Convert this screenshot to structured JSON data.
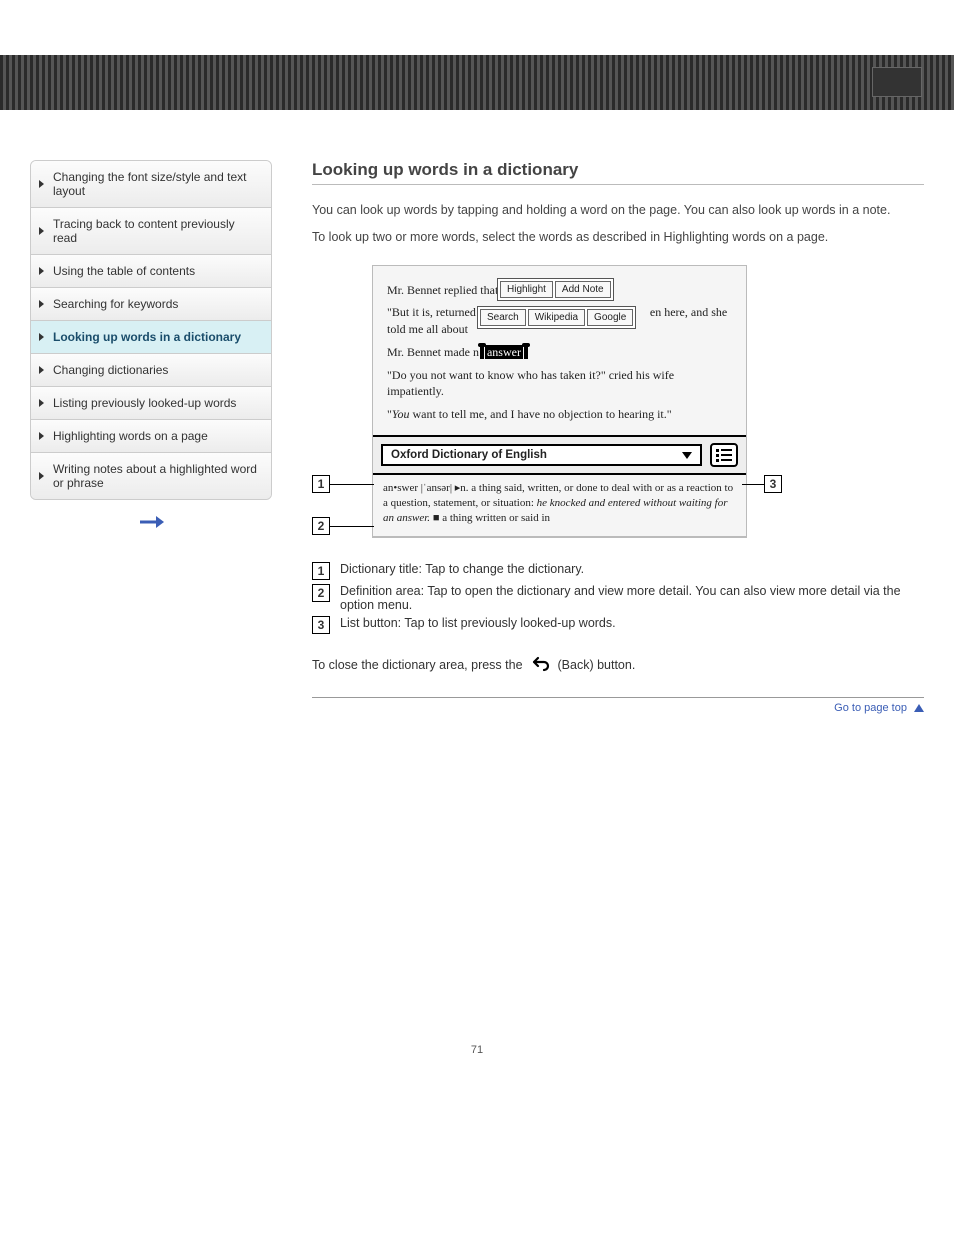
{
  "sidebar": {
    "items": [
      {
        "label": "Changing the font size/style and text layout"
      },
      {
        "label": "Tracing back to content previously read"
      },
      {
        "label": "Using the table of contents"
      },
      {
        "label": "Searching for keywords"
      },
      {
        "label": "Looking up words in a dictionary"
      },
      {
        "label": "Changing dictionaries"
      },
      {
        "label": "Listing previously looked-up words"
      },
      {
        "label": "Highlighting words on a page"
      },
      {
        "label": "Writing notes about a highlighted word or phrase"
      }
    ],
    "active_index": 4
  },
  "content": {
    "heading": "Looking up words in a dictionary",
    "intro_1": "You can look up words by tapping and holding a word on the page. You can also look up words in a note.",
    "intro_2": "To look up two or more words, select the words as described in Highlighting words on a page.",
    "legend": [
      "Dictionary title: Tap to change the dictionary.",
      "Definition area: Tap to open the dictionary and view more detail. You can also view more detail via the option menu.",
      "List button: Tap to list previously looked-up words."
    ],
    "close_note_before": "To close the dictionary area, press the",
    "close_note_after": "(Back) button.",
    "top_link": "Go to page top"
  },
  "ereader": {
    "para1_a": "Mr. Bennet replied that",
    "para2_a": "\"But it is, returned",
    "para2_b": "en here, and she told me all about",
    "para3_a": "Mr. Bennet made n",
    "selected_word": "answer",
    "para4": "\"Do you not want to know who has taken it?\" cried his wife impatiently.",
    "para5_a": "\"",
    "para5_em": "You",
    "para5_b": " want to tell me, and I have no objection to hearing it.\"",
    "popup1": [
      "Highlight",
      "Add Note"
    ],
    "popup2": [
      "Search",
      "Wikipedia",
      "Google"
    ],
    "dict_title": "Oxford Dictionary of English",
    "definition": "an•swer |ˈansər| ▸n.   a thing said, written, or done to deal with or as a reaction to a question, statement, or situation: ",
    "definition_em": "he knocked and entered without waiting for an answer.",
    "definition_tail": "   ■ a thing written or said in"
  },
  "page_number": "71"
}
